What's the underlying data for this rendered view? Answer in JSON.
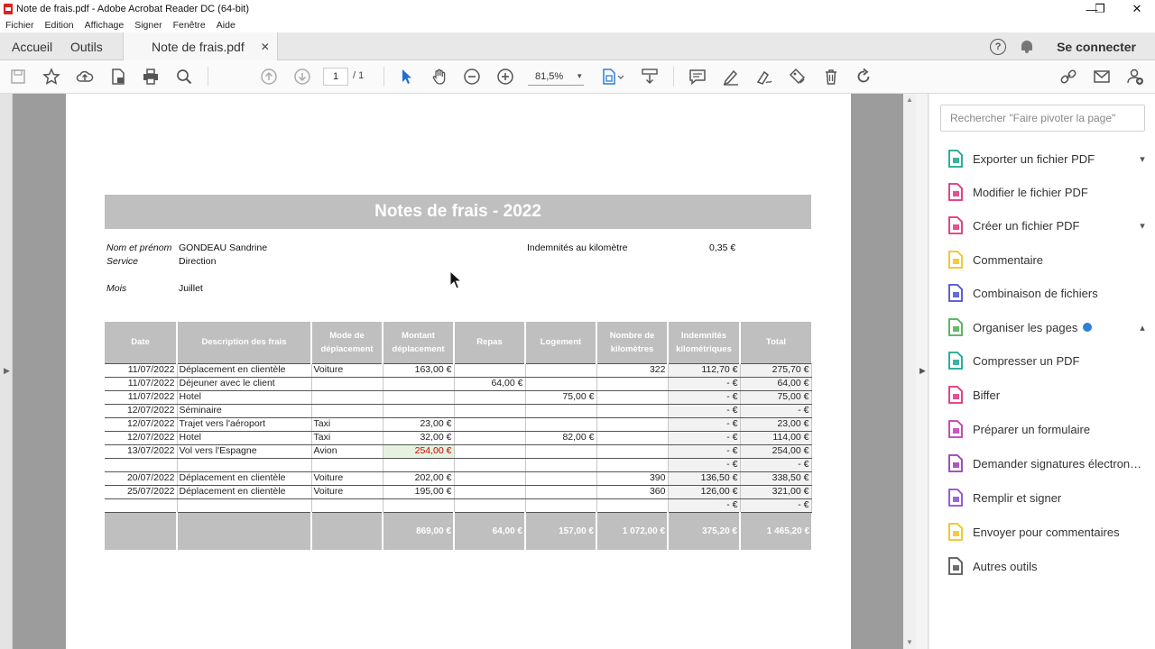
{
  "window": {
    "title": "Note de frais.pdf - Adobe Acrobat Reader DC (64-bit)",
    "minimize": "—",
    "maximize": "❐",
    "close": "✕"
  },
  "menu": [
    "Fichier",
    "Edition",
    "Affichage",
    "Signer",
    "Fenêtre",
    "Aide"
  ],
  "tabs": {
    "home": "Accueil",
    "tools": "Outils",
    "document": "Note de frais.pdf",
    "close": "✕",
    "connect": "Se connecter"
  },
  "toolbar": {
    "page_current": "1",
    "page_total": "/ 1",
    "zoom": "81,5%"
  },
  "document": {
    "title": "Notes de frais - 2022",
    "name_label": "Nom et prénom",
    "name_value": "GONDEAU Sandrine",
    "service_label": "Service",
    "service_value": "Direction",
    "month_label": "Mois",
    "month_value": "Juillet",
    "km_label": "Indemnités au kilomètre",
    "km_value": "0,35 €",
    "headers": [
      "Date",
      "Description des frais",
      "Mode de déplacement",
      "Montant déplacement",
      "Repas",
      "Logement",
      "Nombre de kilomètres",
      "Indemnités kilométriques",
      "Total"
    ],
    "rows": [
      [
        "11/07/2022",
        "Déplacement en clientèle",
        "Voiture",
        "163,00 €",
        "",
        "",
        "322",
        "112,70 €",
        "275,70 €"
      ],
      [
        "11/07/2022",
        "Déjeuner avec le client",
        "",
        "",
        "64,00 €",
        "",
        "",
        "-      €",
        "64,00 €"
      ],
      [
        "11/07/2022",
        "Hotel",
        "",
        "",
        "",
        "75,00 €",
        "",
        "-      €",
        "75,00 €"
      ],
      [
        "12/07/2022",
        "Séminaire",
        "",
        "",
        "",
        "",
        "",
        "-      €",
        "-      €"
      ],
      [
        "12/07/2022",
        "Trajet vers l'aéroport",
        "Taxi",
        "23,00 €",
        "",
        "",
        "",
        "-      €",
        "23,00 €"
      ],
      [
        "12/07/2022",
        "Hotel",
        "Taxi",
        "32,00 €",
        "",
        "82,00 €",
        "",
        "-      €",
        "114,00 €"
      ],
      [
        "13/07/2022",
        "Vol vers l'Espagne",
        "Avion",
        "254,00 €",
        "",
        "",
        "",
        "-      €",
        "254,00 €"
      ],
      [
        "",
        "",
        "",
        "",
        "",
        "",
        "",
        "-      €",
        "-      €"
      ],
      [
        "20/07/2022",
        "Déplacement en clientèle",
        "Voiture",
        "202,00 €",
        "",
        "",
        "390",
        "136,50 €",
        "338,50 €"
      ],
      [
        "25/07/2022",
        "Déplacement en clientèle",
        "Voiture",
        "195,00 €",
        "",
        "",
        "360",
        "126,00 €",
        "321,00 €"
      ],
      [
        "",
        "",
        "",
        "",
        "",
        "",
        "",
        "-      €",
        "-      €"
      ]
    ],
    "totals": [
      "",
      "",
      "",
      "869,00 €",
      "64,00 €",
      "157,00 €",
      "1 072,00 €",
      "375,20 €",
      "1 465,20 €"
    ]
  },
  "panel": {
    "search_placeholder": "Rechercher \"Faire pivoter la page\"",
    "tools": [
      {
        "label": "Exporter un fichier PDF",
        "icon": "export-pdf-icon",
        "color": "#1aa58f"
      },
      {
        "label": "Modifier le fichier PDF",
        "icon": "edit-pdf-icon",
        "color": "#e0317c"
      },
      {
        "label": "Créer un fichier PDF",
        "icon": "create-pdf-icon",
        "color": "#e0317c"
      },
      {
        "label": "Commentaire",
        "icon": "comment-icon",
        "color": "#f2c21b"
      },
      {
        "label": "Combinaison de fichiers",
        "icon": "combine-icon",
        "color": "#4b4fd1"
      },
      {
        "label": "Organiser les pages",
        "icon": "organize-pages-icon",
        "color": "#4caf50"
      },
      {
        "label": "Compresser un PDF",
        "icon": "compress-icon",
        "color": "#1aa58f"
      },
      {
        "label": "Biffer",
        "icon": "redact-icon",
        "color": "#e0317c"
      },
      {
        "label": "Préparer un formulaire",
        "icon": "form-icon",
        "color": "#c13ab6"
      },
      {
        "label": "Demander signatures électron…",
        "icon": "request-signature-icon",
        "color": "#9b3bb7"
      },
      {
        "label": "Remplir et signer",
        "icon": "fill-sign-icon",
        "color": "#8a4bd8"
      },
      {
        "label": "Envoyer pour commentaires",
        "icon": "send-comments-icon",
        "color": "#f2c21b"
      },
      {
        "label": "Autres outils",
        "icon": "more-tools-icon",
        "color": "#555555"
      }
    ]
  }
}
